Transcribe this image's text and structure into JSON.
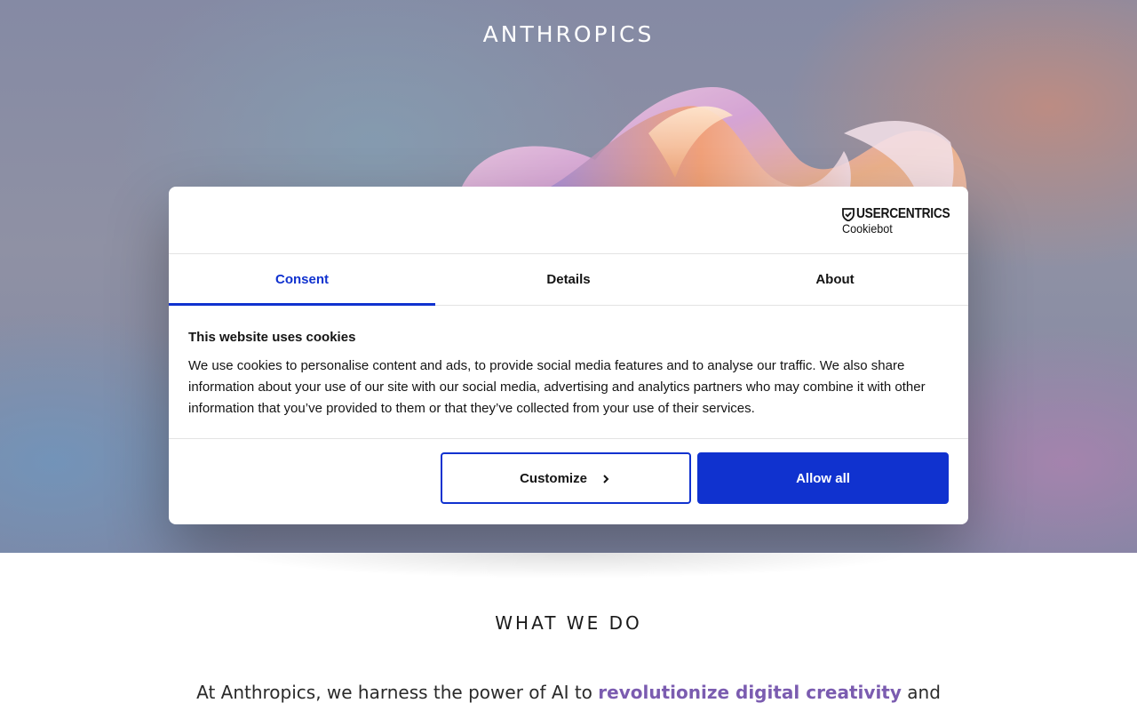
{
  "site": {
    "logo": "ANTHROPICS"
  },
  "cookie_dialog": {
    "brand": {
      "name": "USERCENTRICS",
      "product": "Cookiebot"
    },
    "tabs": [
      {
        "label": "Consent",
        "active": true
      },
      {
        "label": "Details",
        "active": false
      },
      {
        "label": "About",
        "active": false
      }
    ],
    "title": "This website uses cookies",
    "text": "We use cookies to personalise content and ads, to provide social media features and to analyse our traffic. We also share information about your use of our site with our social media, advertising and analytics partners who may combine it with other information that you’ve provided to them or that they’ve collected from your use of their services.",
    "buttons": {
      "customize": "Customize",
      "allow_all": "Allow all"
    }
  },
  "section": {
    "heading": "WHAT WE DO",
    "intro_before": "At Anthropics, we harness the power of AI to ",
    "intro_highlight": "revolutionize digital creativity",
    "intro_after": " and"
  },
  "colors": {
    "accent": "#1032cf",
    "highlight": "#7b5cb0"
  },
  "icons": [
    "cookiebot-shield-icon",
    "chevron-right-icon"
  ]
}
